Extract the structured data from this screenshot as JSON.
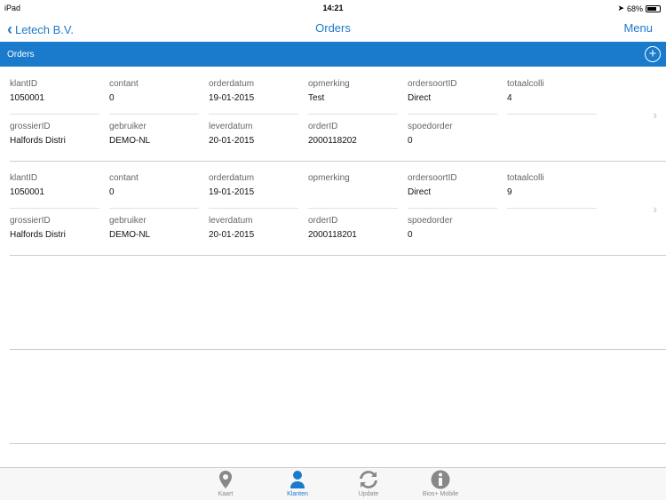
{
  "status": {
    "device": "iPad",
    "time": "14:21",
    "battery": "68%"
  },
  "nav": {
    "back": "Letech B.V.",
    "title": "Orders",
    "menu": "Menu"
  },
  "section": {
    "title": "Orders"
  },
  "labels": {
    "klantID": "klantID",
    "contant": "contant",
    "orderdatum": "orderdatum",
    "opmerking": "opmerking",
    "ordersoortID": "ordersoortID",
    "totaalcolli": "totaalcolli",
    "grossierID": "grossierID",
    "gebruiker": "gebruiker",
    "leverdatum": "leverdatum",
    "orderID": "orderID",
    "spoedorder": "spoedorder"
  },
  "orders": [
    {
      "klantID": "1050001",
      "contant": "0",
      "orderdatum": "19-01-2015",
      "opmerking": "Test",
      "ordersoortID": "Direct",
      "totaalcolli": "4",
      "grossierID": "Halfords Distri",
      "gebruiker": "DEMO-NL",
      "leverdatum": "20-01-2015",
      "orderID": "2000118202",
      "spoedorder": "0"
    },
    {
      "klantID": "1050001",
      "contant": "0",
      "orderdatum": "19-01-2015",
      "opmerking": "",
      "ordersoortID": "Direct",
      "totaalcolli": "9",
      "grossierID": "Halfords Distri",
      "gebruiker": "DEMO-NL",
      "leverdatum": "20-01-2015",
      "orderID": "2000118201",
      "spoedorder": "0"
    }
  ],
  "tabs": [
    {
      "label": "Kaart"
    },
    {
      "label": "Klanten"
    },
    {
      "label": "Update"
    },
    {
      "label": "Bios+ Mobile"
    }
  ],
  "colors": {
    "accent": "#1a7acb"
  }
}
